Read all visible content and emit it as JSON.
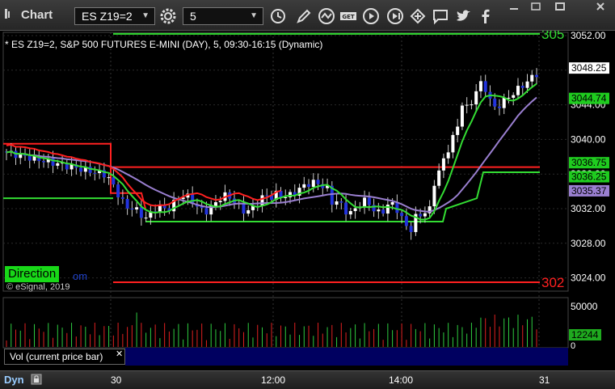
{
  "toolbar": {
    "title": "Chart",
    "symbol": "ES Z19=2",
    "interval": "5"
  },
  "info": {
    "description": "* ES Z19=2, S&P 500 FUTURES E-MINI (DAY), 5, 09:30-16:15 (Dynamic)"
  },
  "labels": {
    "direction": "Direction",
    "direction_tail": "om",
    "copyright": "© eSignal, 2019",
    "vol_panel": "Vol (current price bar)",
    "close_glyph": "✕",
    "dyn": "Dyn"
  },
  "colors": {
    "background": "#000000",
    "green_line": "#33dd33",
    "red_line": "#ff2020",
    "purple_line": "#9a7fd0",
    "up_candle": "#ffffff",
    "down_candle": "#2233dd",
    "volume_panel_bg": "#000060"
  },
  "chart_data": {
    "type": "candlestick",
    "price_axis": {
      "ylim": [
        3021.5,
        3053
      ],
      "ticks": [
        "3052.00",
        "3048.00",
        "3044.00",
        "3040.00",
        "3036.00",
        "3032.00",
        "3028.00",
        "3024.00"
      ],
      "tick_values": [
        3052,
        3048,
        3044,
        3040,
        3036,
        3032,
        3028,
        3024
      ]
    },
    "time_axis": {
      "labels": [
        "30",
        "12:00",
        "14:00",
        "31"
      ]
    },
    "price_markers": [
      {
        "label": "3048.25",
        "value": 3048.25,
        "style": "white"
      },
      {
        "label": "3044.74",
        "value": 3044.74,
        "style": "green"
      },
      {
        "label": "3036.75",
        "value": 3036.75,
        "style": "green"
      },
      {
        "label": "3036.25",
        "value": 3036.25,
        "style": "green"
      },
      {
        "label": "3035.37",
        "value": 3035.37,
        "style": "purple"
      }
    ],
    "level_labels": [
      {
        "text": "305",
        "value": 3052.2,
        "color": "#33dd33"
      },
      {
        "text": "302",
        "value": 3023.5,
        "color": "#ff2020"
      }
    ],
    "volume_axis": {
      "ticks": [
        "50000",
        "0"
      ],
      "last": "12244"
    }
  }
}
